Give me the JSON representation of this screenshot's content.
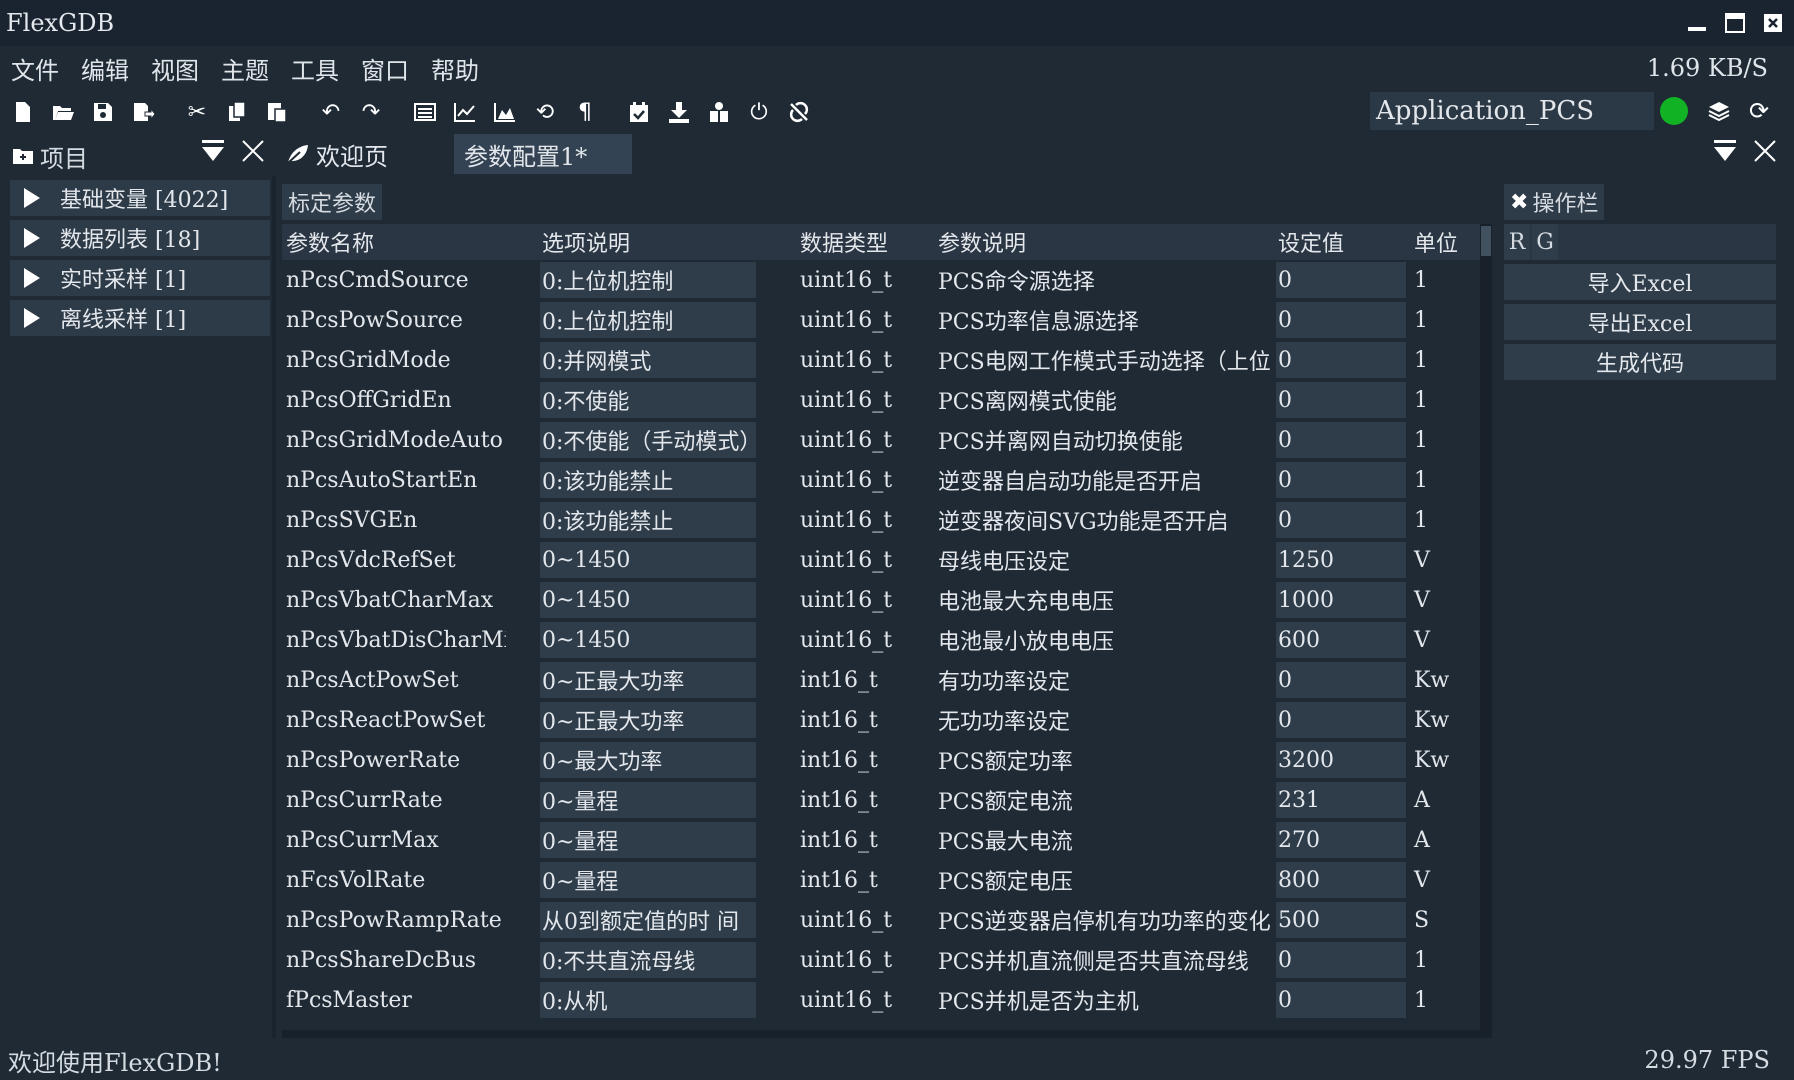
{
  "window": {
    "title": "FlexGDB"
  },
  "menu": {
    "items": [
      "文件",
      "编辑",
      "视图",
      "主题",
      "工具",
      "窗口",
      "帮助"
    ],
    "speed": "1.69 KB/S"
  },
  "toolbar": {
    "project_name": "Application_PCS",
    "status_color": "#11b325"
  },
  "left_panel": {
    "title": "项目",
    "items": [
      {
        "label": "基础变量 [4022]"
      },
      {
        "label": "数据列表 [18]"
      },
      {
        "label": "实时采样 [1]"
      },
      {
        "label": "离线采样 [1]"
      }
    ]
  },
  "tabs": [
    {
      "label": "欢迎页"
    },
    {
      "label": "参数配置1*"
    }
  ],
  "table": {
    "section_title": "标定参数",
    "headers": [
      "参数名称",
      "选项说明",
      "数据类型",
      "参数说明",
      "设定值",
      "单位"
    ],
    "rows": [
      [
        "nPcsCmdSource",
        "0:上位机控制",
        "uint16_t",
        "PCS命令源选择",
        "0",
        "1"
      ],
      [
        "nPcsPowSource",
        "0:上位机控制",
        "uint16_t",
        "PCS功率信息源选择",
        "0",
        "1"
      ],
      [
        "nPcsGridMode",
        "0:并网模式",
        "uint16_t",
        "PCS电网工作模式手动选择（上位",
        "0",
        "1"
      ],
      [
        "nPcsOffGridEn",
        "0:不使能",
        "uint16_t",
        "PCS离网模式使能",
        "0",
        "1"
      ],
      [
        "nPcsGridModeAuto",
        "0:不使能（手动模式）",
        "uint16_t",
        "PCS并离网自动切换使能",
        "0",
        "1"
      ],
      [
        "nPcsAutoStartEn",
        "0:该功能禁止",
        "uint16_t",
        "逆变器自启动功能是否开启",
        "0",
        "1"
      ],
      [
        "nPcsSVGEn",
        "0:该功能禁止",
        "uint16_t",
        "逆变器夜间SVG功能是否开启",
        "0",
        "1"
      ],
      [
        "nPcsVdcRefSet",
        "0~1450",
        "uint16_t",
        "母线电压设定",
        "1250",
        "V"
      ],
      [
        "nPcsVbatCharMax",
        "0~1450",
        "uint16_t",
        "电池最大充电电压",
        "1000",
        "V"
      ],
      [
        "nPcsVbatDisCharMin",
        "0~1450",
        "uint16_t",
        "电池最小放电电压",
        "600",
        "V"
      ],
      [
        "nPcsActPowSet",
        "0~正最大功率",
        "int16_t",
        "有功功率设定",
        "0",
        "Kw"
      ],
      [
        "nPcsReactPowSet",
        "0~正最大功率",
        "int16_t",
        "无功功率设定",
        "0",
        "Kw"
      ],
      [
        "nPcsPowerRate",
        "0~最大功率",
        "int16_t",
        "PCS额定功率",
        "3200",
        "Kw"
      ],
      [
        "nPcsCurrRate",
        "0~量程",
        "int16_t",
        "PCS额定电流",
        "231",
        "A"
      ],
      [
        "nPcsCurrMax",
        "0~量程",
        "int16_t",
        "PCS最大电流",
        "270",
        "A"
      ],
      [
        "nFcsVolRate",
        "0~量程",
        "int16_t",
        "PCS额定电压",
        "800",
        "V"
      ],
      [
        "nPcsPowRampRate",
        "从0到额定值的时 间",
        "uint16_t",
        "PCS逆变器启停机有功功率的变化",
        "500",
        "S"
      ],
      [
        "nPcsShareDcBus",
        "0:不共直流母线",
        "uint16_t",
        "PCS并机直流侧是否共直流母线",
        "0",
        "1"
      ],
      [
        "fPcsMaster",
        "0:从机",
        "uint16_t",
        "PCS并机是否为主机",
        "0",
        "1"
      ]
    ]
  },
  "ops_panel": {
    "title": "操作栏",
    "r_label": "R",
    "g_label": "G",
    "buttons": [
      "导入Excel",
      "导出Excel",
      "生成代码"
    ]
  },
  "status": {
    "message": "欢迎使用FlexGDB!",
    "fps": "29.97 FPS"
  }
}
